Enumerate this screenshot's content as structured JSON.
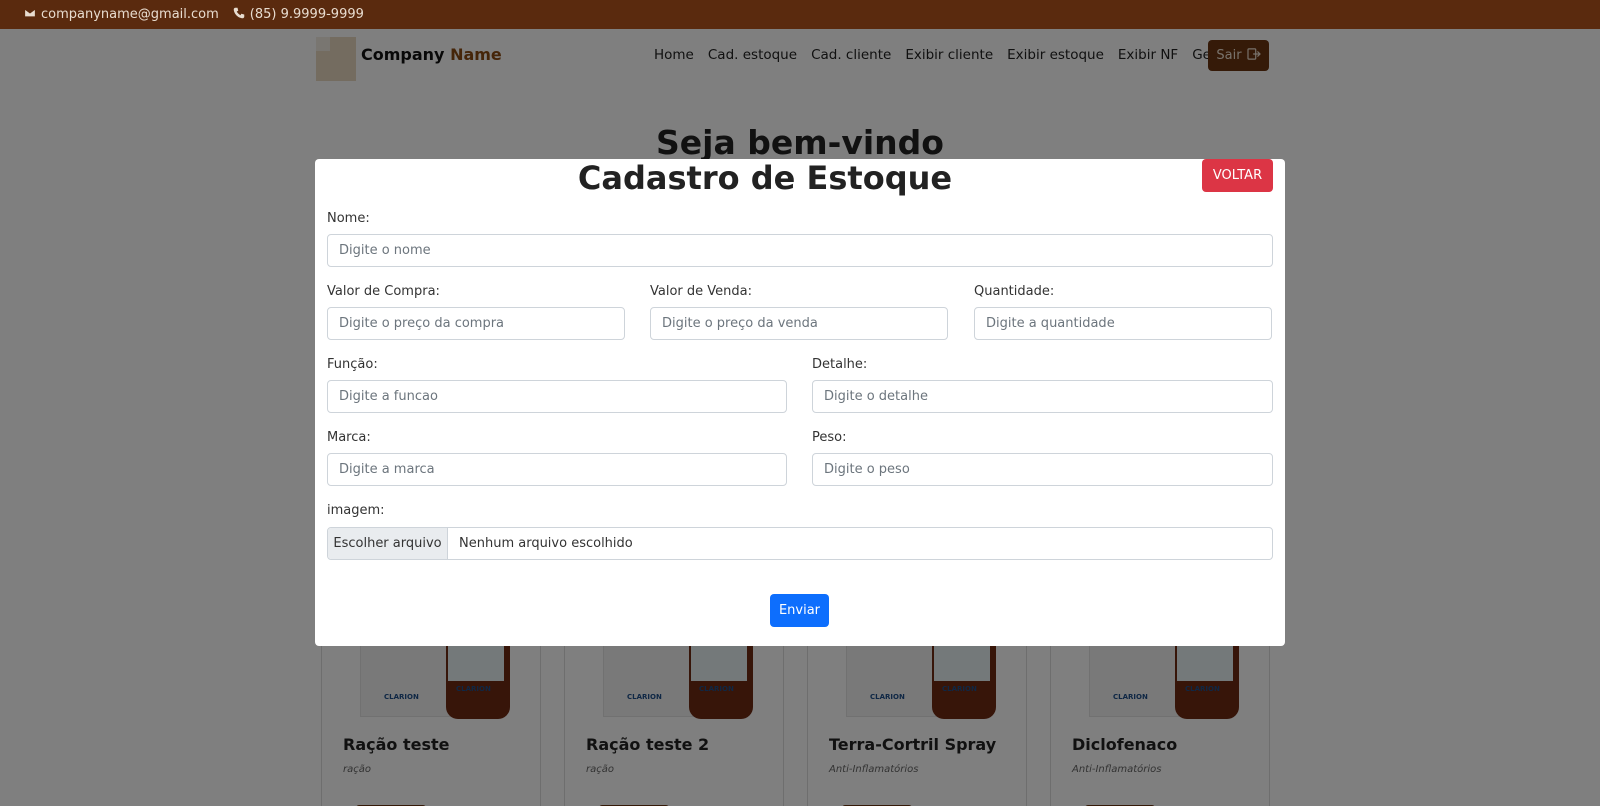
{
  "topbar": {
    "email": "companyname@gmail.com",
    "phone": "(85) 9.9999-9999",
    "email_icon": "mail-icon",
    "phone_icon": "phone-icon",
    "background": "#5a2a0e"
  },
  "navbar": {
    "brand_primary": "Company",
    "brand_accent": "Name",
    "links": [
      "Home",
      "Cad. estoque",
      "Cad. cliente",
      "Exibir cliente",
      "Exibir estoque",
      "Exibir NF",
      "Gerar NF"
    ],
    "logout_label": "Sair",
    "logout_icon": "logout-icon",
    "accent_color": "#6b3410"
  },
  "page": {
    "welcome": "Seja bem-vindo",
    "products": [
      {
        "name": "Ração teste",
        "category": "ração",
        "brand_mark": "CLARION"
      },
      {
        "name": "Ração teste 2",
        "category": "ração",
        "brand_mark": "CLARION"
      },
      {
        "name": "Terra-Cortril Spray",
        "category": "Anti-Inflamatórios",
        "brand_mark": "CLARION"
      },
      {
        "name": "Diclofenaco",
        "category": "Anti-Inflamatórios",
        "brand_mark": "CLARION"
      }
    ]
  },
  "modal": {
    "title": "Cadastro de Estoque",
    "back_label": "VOLTAR",
    "fields": {
      "nome": {
        "label": "Nome:",
        "placeholder": "Digite o nome"
      },
      "valor_compra": {
        "label": "Valor de Compra:",
        "placeholder": "Digite o preço da compra"
      },
      "valor_venda": {
        "label": "Valor de Venda:",
        "placeholder": "Digite o preço da venda"
      },
      "quantidade": {
        "label": "Quantidade:",
        "placeholder": "Digite a quantidade"
      },
      "funcao": {
        "label": "Função:",
        "placeholder": "Digite a funcao"
      },
      "detalhe": {
        "label": "Detalhe:",
        "placeholder": "Digite o detalhe"
      },
      "marca": {
        "label": "Marca:",
        "placeholder": "Digite a marca"
      },
      "peso": {
        "label": "Peso:",
        "placeholder": "Digite o peso"
      },
      "imagem": {
        "label": "imagem:",
        "button": "Escolher arquivo",
        "status": "Nenhum arquivo escolhido"
      }
    },
    "submit_label": "Enviar",
    "submit_color": "#0d6efd",
    "back_color": "#dc3545"
  }
}
